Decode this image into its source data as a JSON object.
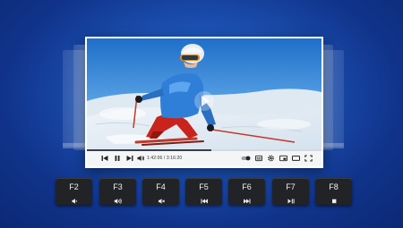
{
  "player": {
    "time": "1:42:06 / 3:16:20",
    "progress_fraction": 0.53,
    "icons": [
      "skip-back-icon",
      "pause-icon",
      "skip-forward-icon",
      "volume-icon",
      "toggle-icon",
      "subtitles-icon",
      "settings-icon",
      "pip-icon",
      "theater-icon",
      "fullscreen-icon"
    ]
  },
  "keys": [
    {
      "label": "F2",
      "icon": "volume-down-icon"
    },
    {
      "label": "F3",
      "icon": "volume-up-icon"
    },
    {
      "label": "F4",
      "icon": "mute-icon"
    },
    {
      "label": "F5",
      "icon": "previous-track-icon"
    },
    {
      "label": "F6",
      "icon": "next-track-icon"
    },
    {
      "label": "F7",
      "icon": "play-pause-icon"
    },
    {
      "label": "F8",
      "icon": "stop-icon"
    }
  ],
  "colors": {
    "background": "#1b4fb0",
    "key": "#222327",
    "jacket": "#2f7fd8",
    "pants": "#c9231c"
  }
}
